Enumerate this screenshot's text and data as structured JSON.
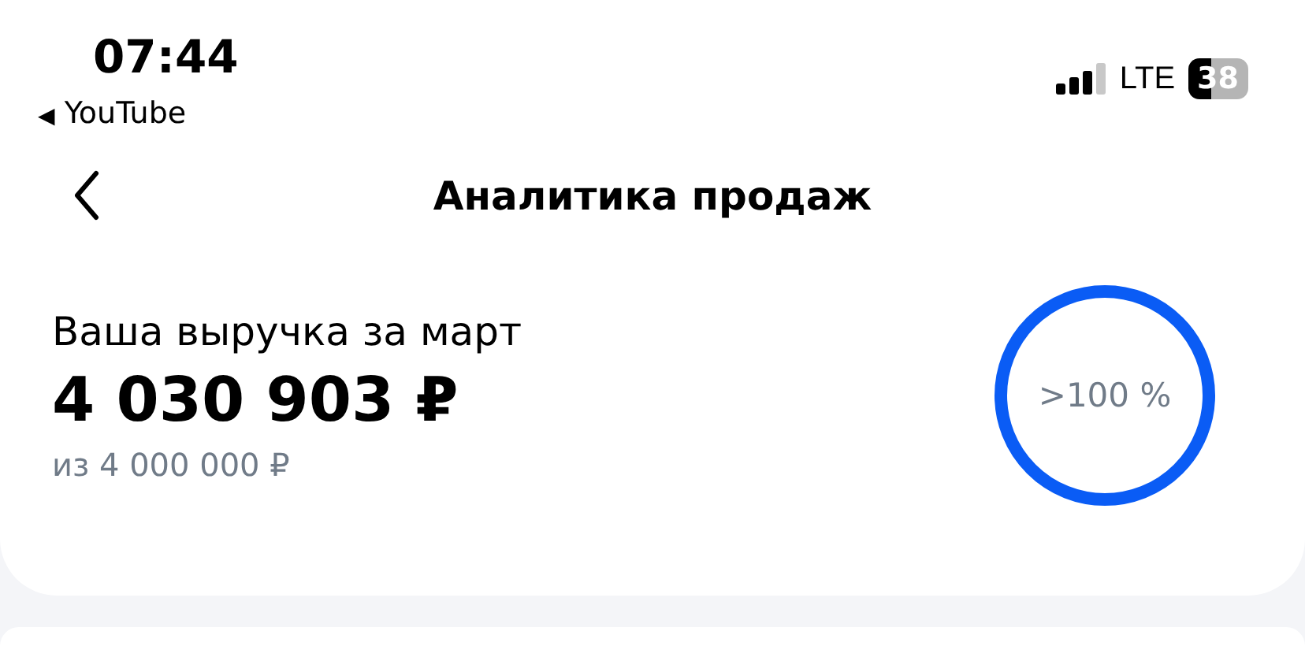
{
  "status_bar": {
    "time": "07:44",
    "back_app": "YouTube",
    "back_glyph": "◀",
    "network": "LTE",
    "battery": "38"
  },
  "header": {
    "title": "Аналитика продаж"
  },
  "revenue": {
    "label": "Ваша выручка за март",
    "amount": "4 030 903 ₽",
    "target": "из 4 000 000 ₽",
    "progress": {
      "text": ">100 %",
      "level": 1
    }
  }
}
